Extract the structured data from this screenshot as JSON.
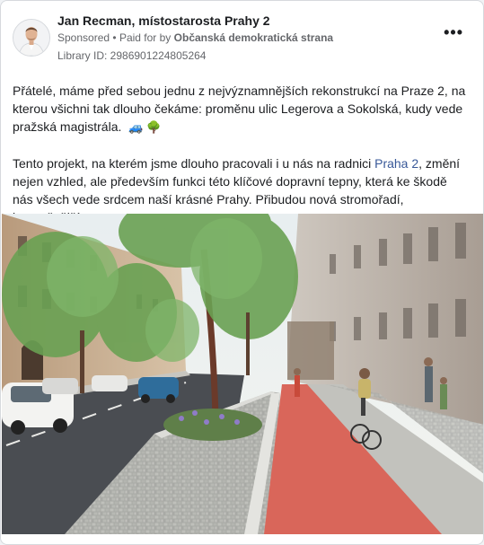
{
  "post": {
    "author": "Jan Recman, místostarosta Prahy 2",
    "sponsored": "Sponsored",
    "paid_for_by_prefix": "Paid for by",
    "paid_for_by": "Občanská demokratická strana",
    "library_id": "Library ID: 2986901224805264",
    "more_options": "•••",
    "paragraph1": "Přátelé, máme před sebou jednu z nejvýznamnějších rekonstrukcí na Praze 2, na kterou všichni tak dlouho čekáme: proměnu ulic Legerova a Sokolská, kudy vede pražská magistrála.",
    "paragraph1_emojis": "🚙 🌳",
    "paragraph2_start": "Tento projekt, na kterém jsme dlouho pracovali i u nás na radnici ",
    "paragraph2_link": "Praha 2",
    "paragraph2_end": ", změní nejen vzhled, ale především funkci této klíčové dopravní tepny, která ke škodě nás všech vede srdcem naší krásné Prahy. Přibudou nová stromořadí, bezpečnější…"
  },
  "colors": {
    "link": "#385898",
    "meta": "#65676b",
    "bike_lane": "#d9665a",
    "asphalt": "#4a4d52"
  },
  "icons": {
    "more": "more-options-icon",
    "avatar": "profile-photo",
    "separator": "dot-separator"
  }
}
